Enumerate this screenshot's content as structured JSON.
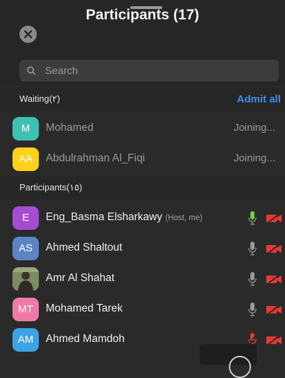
{
  "header": {
    "title": "Participants (17)"
  },
  "search": {
    "placeholder": "Search"
  },
  "waiting": {
    "label": "Waiting(٢)",
    "admit_all": "Admit all",
    "items": [
      {
        "initials": "M",
        "name": "Mohamed",
        "status": "Joining...",
        "color": "#3dc1b0"
      },
      {
        "initials": "AA",
        "name": "Abdulrahman Al_Fiqi",
        "status": "Joining...",
        "color": "#ffd11a"
      }
    ]
  },
  "participants": {
    "label": "Participants(١٥)",
    "items": [
      {
        "initials": "E",
        "name": "Eng_Basma Elsharkawy",
        "tag": "(Host, me)",
        "color": "#a64cd0",
        "mic": "on",
        "camera": "off"
      },
      {
        "initials": "AS",
        "name": "Ahmed Shaltout",
        "color": "#5b84c4",
        "mic": "muted",
        "camera": "off"
      },
      {
        "initials": "",
        "name": "Amr Al Shahat",
        "color": "#7a8a5a",
        "mic": "muted",
        "camera": "off",
        "photo": true
      },
      {
        "initials": "MT",
        "name": "Mohamed Tarek",
        "color": "#ee7aa6",
        "mic": "muted",
        "camera": "off"
      },
      {
        "initials": "AM",
        "name": "Ahmed Mamdoh",
        "color": "#3fa2e6",
        "mic": "off",
        "camera": "off"
      }
    ]
  },
  "colors": {
    "accent": "#3b8ff2",
    "mic_on": "#6dcf4a",
    "muted_red": "#e53935"
  }
}
